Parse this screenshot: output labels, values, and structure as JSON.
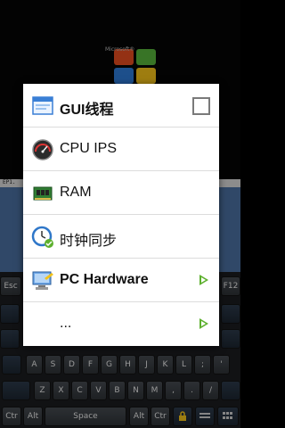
{
  "background": {
    "logo_text": "Microsoft®",
    "status_text": "EP1."
  },
  "keyboard": {
    "keys": [
      "Esc",
      "F12",
      "A",
      "S",
      "D",
      "F",
      "G",
      "H",
      "J",
      "K",
      "L",
      ";",
      "'",
      "Z",
      "X",
      "C",
      "V",
      "B",
      "N",
      "M",
      ",",
      ".",
      "/",
      "Ctr",
      "Alt",
      "Space",
      "Alt",
      "Ctr"
    ]
  },
  "menu": {
    "items": [
      {
        "label": "GUI线程",
        "icon": "window-icon",
        "bold": true,
        "control": "checkbox",
        "checked": false
      },
      {
        "label": "CPU IPS",
        "icon": "gauge-icon",
        "bold": false,
        "control": "none"
      },
      {
        "label": "RAM",
        "icon": "ram-chip-icon",
        "bold": false,
        "control": "none"
      },
      {
        "label": "时钟同步",
        "icon": "clock-sync-icon",
        "bold": false,
        "control": "none"
      },
      {
        "label": "PC Hardware",
        "icon": "hardware-icon",
        "bold": true,
        "control": "submenu-arrow"
      },
      {
        "label": "...",
        "icon": "",
        "bold": false,
        "control": "submenu-arrow"
      }
    ],
    "accent_color": "#5db02e"
  }
}
